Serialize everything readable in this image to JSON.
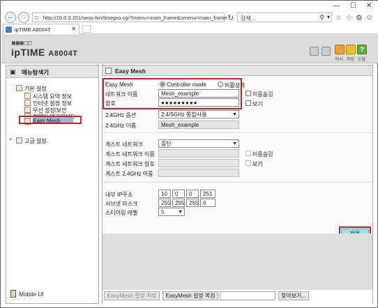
{
  "browser": {
    "url": "http://10.0.0.251/sess-bin/timepro.cgi?tmenu=main_frame&smenu=main_frame",
    "search_placeholder": "검색...",
    "tab_title": "ipTIME A8004T",
    "window_controls": [
      "—",
      "☐",
      "✕"
    ]
  },
  "header": {
    "logo_text": "ipTIME",
    "model": "A8004T",
    "icon_labels": [
      "마시",
      "저장",
      "도움"
    ]
  },
  "sidebar": {
    "title": "메뉴탐색기",
    "root": "기본 설정",
    "items": [
      "시스템 요약 정보",
      "인터넷 설정 정보",
      "무선 설정/보안",
      "펌웨어 업그레이드",
      "Easy Mesh"
    ],
    "advanced": "고급 설정",
    "mobile": "Mobile UI"
  },
  "panel": {
    "title": "Easy Mesh",
    "easymesh_label": "Easy Mesh",
    "mode_controller": "Controller mode",
    "mode_disable": "비활성화",
    "network_name_label": "네트워크 이름",
    "network_name_value": "Mesh_example",
    "hide_name_label": "이름숨김",
    "password_label": "암호",
    "password_value": "●●●●●●●●●",
    "show_label": "보기",
    "option_24_label": "2.4GHz 옵션",
    "option_24_value": "2.4/5GHz 통합사용",
    "name_24_label": "2.4GHz 이름",
    "name_24_value": "Mesh_example",
    "guest_network_label": "게스트 네트워크",
    "guest_network_value": "중단",
    "guest_name_label": "게스트 네트워크 이름",
    "guest_hide_label": "이름숨김",
    "guest_password_label": "게스트 네트워크 암호",
    "guest_show_label": "보기",
    "guest_24_label": "게스트 2.4GHz 이름",
    "internal_ip_label": "내부 IP주소",
    "ip": [
      "10",
      "0",
      "0",
      "251"
    ],
    "subnet_label": "서브넷 마스크",
    "subnet": [
      "255",
      "255",
      "255",
      "0"
    ],
    "steering_label": "스티어링 레벨",
    "steering_value": "5",
    "apply_button": "적용",
    "save_button": "EasyMesh 설정 저장",
    "restore_button": "EasyMesh 설정 복원",
    "browse_button": "찾아보기..."
  }
}
